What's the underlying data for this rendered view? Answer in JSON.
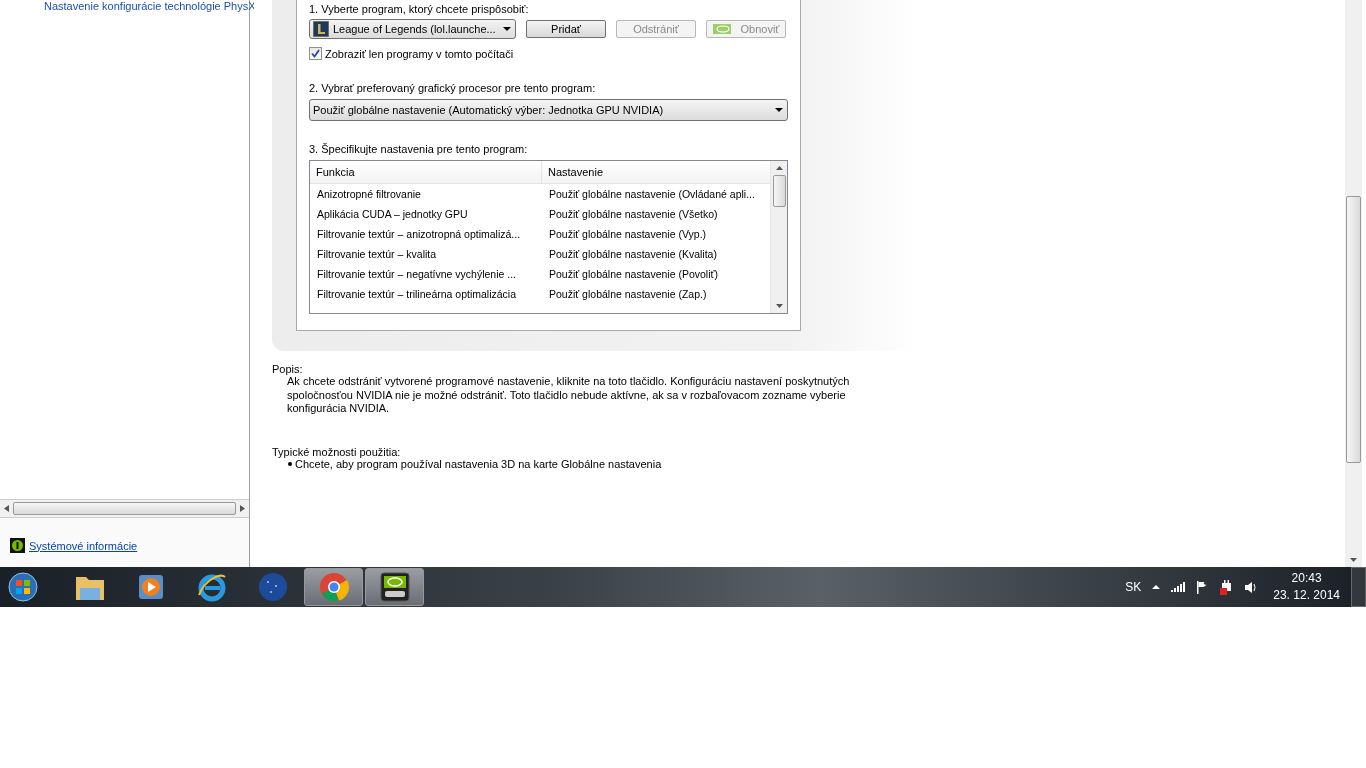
{
  "sidebar": {
    "tree_item": "Nastavenie konfigurácie technológie PhysX",
    "link": "Systémové informácie"
  },
  "program_settings": {
    "step1_label": "1. Vyberte program, ktorý chcete prispôsobiť:",
    "program_dropdown": {
      "value": "League of Legends (lol.launche..."
    },
    "buttons": [
      {
        "label": "Pridať",
        "disabled": false,
        "kind": "plain"
      },
      {
        "label": "Odstrániť",
        "disabled": true,
        "kind": "plain"
      },
      {
        "label": "Obnoviť",
        "disabled": true,
        "kind": "nvidia"
      }
    ],
    "show_only_checkbox": {
      "label": "Zobraziť len programy v tomto počítači",
      "checked": true
    },
    "step2_label": "2. Vybrať preferovaný grafický procesor pre tento program:",
    "gpu_dropdown": {
      "value": "Použiť globálne nastavenie (Automatický výber: Jednotka GPU NVIDIA)"
    },
    "step3_label": "3. Špecifikujte nastavenia pre tento program:",
    "table": {
      "columns": [
        "Funkcia",
        "Nastavenie"
      ],
      "rows": [
        {
          "cells": [
            "Anizotropné filtrovanie",
            "Použiť globálne nastavenie (Ovládané apli..."
          ]
        },
        {
          "cells": [
            "Aplikácia CUDA – jednotky GPU",
            "Použiť globálne nastavenie (Všetko)"
          ]
        },
        {
          "cells": [
            "Filtrovanie textúr – anizotropná optimalizá...",
            "Použiť globálne nastavenie (Vyp.)"
          ]
        },
        {
          "cells": [
            "Filtrovanie textúr – kvalita",
            "Použiť globálne nastavenie (Kvalita)"
          ]
        },
        {
          "cells": [
            "Filtrovanie textúr – negatívne vychýlenie ...",
            "Použiť globálne nastavenie (Povoliť)"
          ]
        },
        {
          "cells": [
            "Filtrovanie textúr – trilineárna optimalizácia",
            "Použiť globálne nastavenie (Zap.)"
          ]
        }
      ]
    }
  },
  "description": {
    "heading": "Popis:",
    "text": "Ak chcete odstrániť vytvorené programové nastavenie, kliknite na toto tlačidlo. Konfiguráciu nastavení poskytnutých spoločnosťou NVIDIA nie je možné odstrániť. Toto tlačidlo nebude aktívne, ak sa v rozbaľovacom zozname vyberie konfigurácia NVIDIA."
  },
  "typical_usage": {
    "heading": "Typické možnosti použitia:",
    "items": [
      "Chcete, aby program používal nastavenia 3D na karte Globálne nastavenia"
    ]
  },
  "taskbar": {
    "apps": [
      {
        "kind": "folder",
        "running": false
      },
      {
        "kind": "media",
        "running": false
      },
      {
        "kind": "browser-e",
        "running": false
      },
      {
        "kind": "globe",
        "running": false
      },
      {
        "kind": "chrome",
        "running": true
      },
      {
        "kind": "nvidia",
        "running": true
      }
    ],
    "language": "SK",
    "time": "20:43",
    "date": "23. 12. 2014"
  }
}
